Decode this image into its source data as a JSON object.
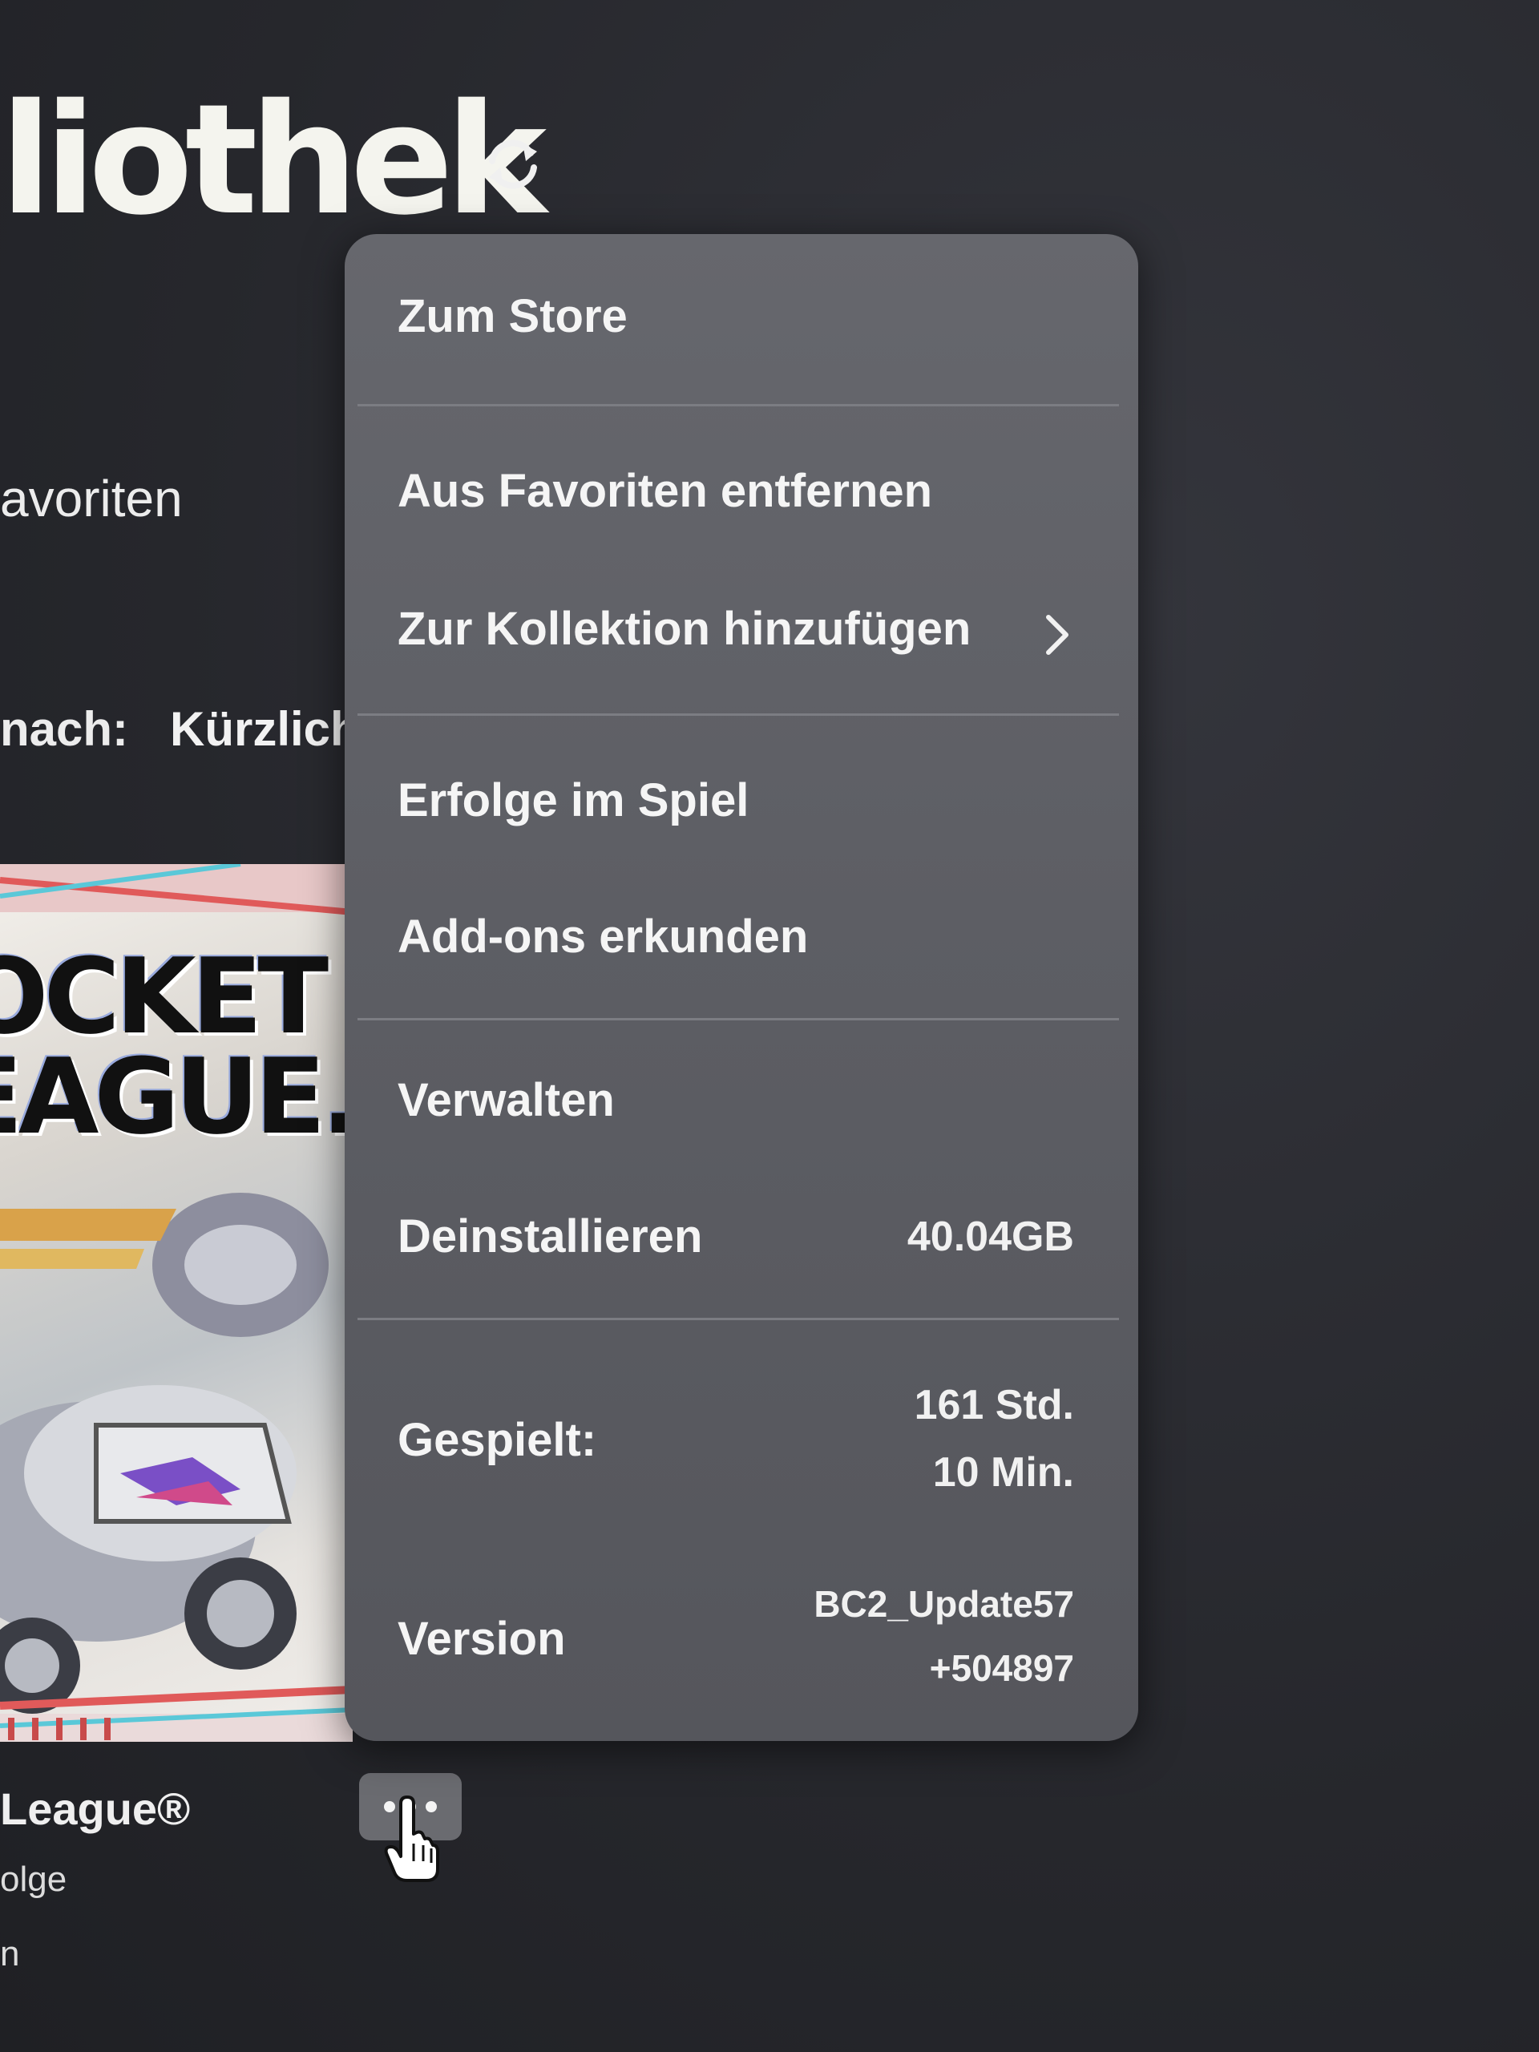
{
  "header": {
    "title": "liothek"
  },
  "filters": {
    "favorites_label": "avoriten",
    "sort_label": "nach:",
    "sort_value": "Kürzlich"
  },
  "game": {
    "tile_logo_line1": "OCKET",
    "tile_logo_line2": "EAGUE.",
    "name": "League®",
    "sub1": "olge",
    "sub2": "n"
  },
  "context_menu": {
    "store": "Zum Store",
    "remove_favorite": "Aus Favoriten entfernen",
    "add_collection": "Zur Kollektion hinzufügen",
    "achievements": "Erfolge im Spiel",
    "addons": "Add-ons erkunden",
    "manage": "Verwalten",
    "uninstall": "Deinstallieren",
    "uninstall_size": "40.04GB",
    "played_label": "Gespielt:",
    "played_hours": "161 Std.",
    "played_minutes": "10 Min.",
    "version_label": "Version",
    "version_line1": "BC2_Update57",
    "version_line2": "+504897"
  },
  "icons": {
    "refresh": "refresh-icon",
    "chevron": "chevron-right-icon",
    "more": "more-dots-icon",
    "cursor": "hand-pointer-icon"
  }
}
